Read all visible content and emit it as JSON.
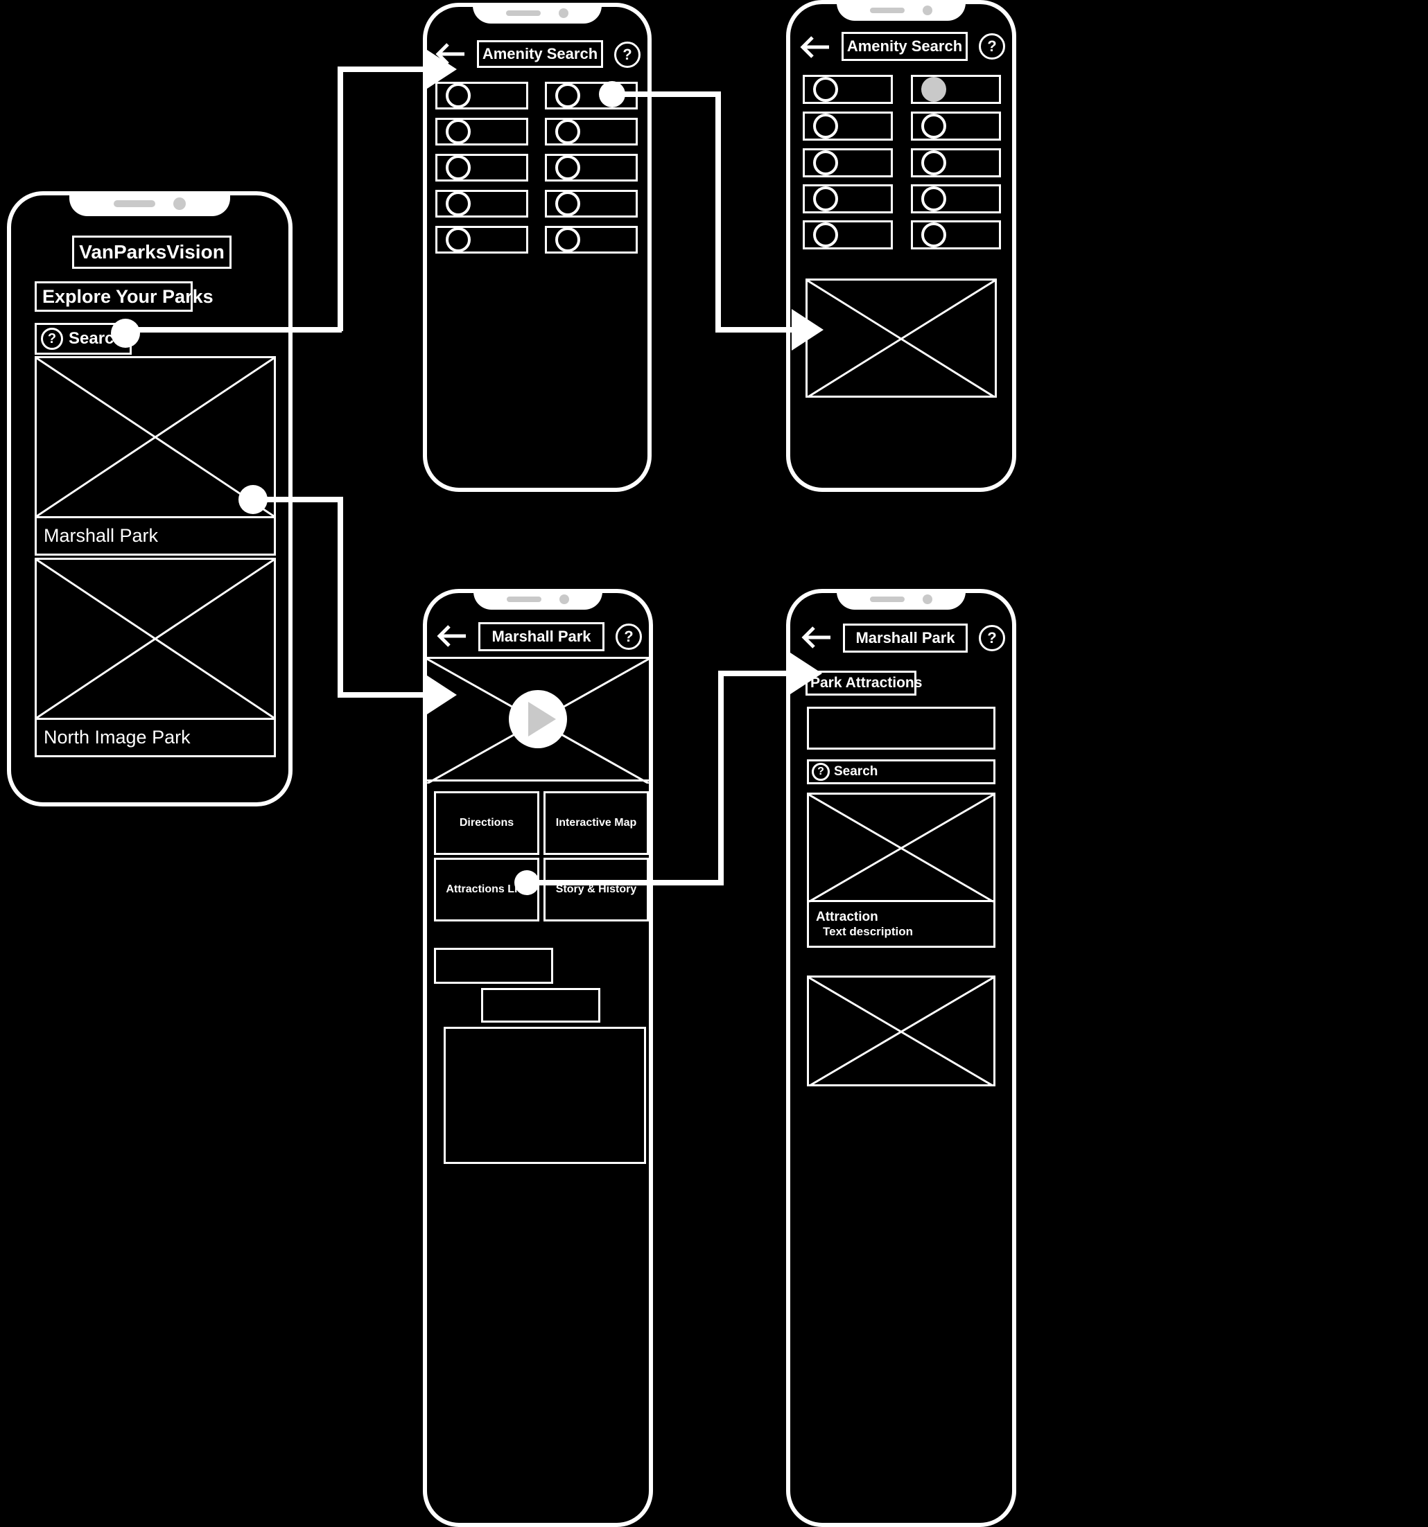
{
  "app": {
    "name": "VanParksVision",
    "type": "mobile-app-wireframe-flow"
  },
  "screens": [
    {
      "id": "home",
      "app_title": "VanParksVision",
      "section_heading": "Explore Your Parks",
      "search": {
        "label": "Search",
        "icon": "question-mark-icon"
      },
      "cards": [
        {
          "caption": "Marshall Park"
        },
        {
          "caption": "North Image Park"
        }
      ]
    },
    {
      "id": "amenity-search-empty",
      "title": "Amenity Search",
      "back_icon": "back-arrow-icon",
      "help_icon": "question-mark-icon",
      "radio_rows": 5,
      "radio_cols": 2,
      "selected_index": null
    },
    {
      "id": "amenity-search-result",
      "title": "Amenity Search",
      "back_icon": "back-arrow-icon",
      "help_icon": "question-mark-icon",
      "radio_rows": 5,
      "radio_cols": 2,
      "selected_index": 1,
      "has_result_image": true
    },
    {
      "id": "park-detail",
      "title": "Marshall Park",
      "back_icon": "back-arrow-icon",
      "help_icon": "question-mark-icon",
      "media": {
        "type": "video-placeholder",
        "play_icon": "play-icon"
      },
      "tiles": [
        "Directions",
        "Interactive Map",
        "Attractions List",
        "Story & History"
      ]
    },
    {
      "id": "park-attractions",
      "title": "Marshall Park",
      "back_icon": "back-arrow-icon",
      "help_icon": "question-mark-icon",
      "section_heading": "Park Attractions",
      "search": {
        "label": "Search",
        "icon": "question-mark-icon"
      },
      "attraction": {
        "name": "Attraction",
        "description": "Text description"
      }
    }
  ],
  "colors": {
    "background": "#000000",
    "stroke": "#ffffff",
    "accent_gray": "#c9c9c9"
  }
}
